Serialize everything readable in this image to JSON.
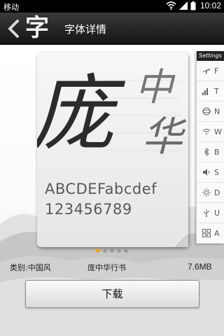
{
  "status_bar": {
    "carrier": "移动",
    "time": "10:02",
    "icons": [
      "wifi-icon",
      "signal-icon",
      "battery-icon"
    ]
  },
  "header": {
    "back_icon": "chevron-left-icon",
    "app_glyph": "字",
    "title": "字体详情"
  },
  "preview": {
    "calligraphy_chars": [
      "庞",
      "中",
      "华"
    ],
    "sample_upper": "ABCDEFabcdef",
    "sample_digits": "123456789",
    "settings_peek": {
      "header": "Settings",
      "rows": [
        {
          "icon": "airplane-icon",
          "label": "F"
        },
        {
          "icon": "signal-bars-icon",
          "label": "T"
        },
        {
          "icon": "globe-icon",
          "label": "N"
        },
        {
          "icon": "wifi-icon",
          "label": "W"
        },
        {
          "icon": "bluetooth-icon",
          "label": "B"
        },
        {
          "icon": "sound-icon",
          "label": "S"
        },
        {
          "icon": "brightness-icon",
          "label": "D"
        },
        {
          "icon": "usb-icon",
          "label": "U"
        },
        {
          "icon": "apps-icon",
          "label": "A"
        }
      ]
    },
    "page_dots": {
      "count": 5,
      "active_index": 0
    }
  },
  "details": {
    "category": "类别:中国风",
    "font_name": "庞中华行书",
    "size": "7.6MB"
  },
  "actions": {
    "download_label": "下载"
  },
  "colors": {
    "status_bar": "#000000",
    "title_bar": "#1e1e1e",
    "dot_active": "#f0a020",
    "dot_inactive": "#9a9a9a"
  }
}
